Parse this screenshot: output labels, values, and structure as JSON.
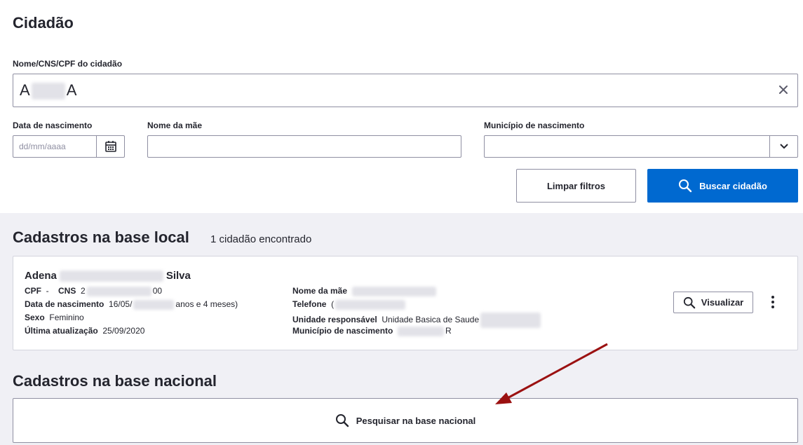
{
  "page": {
    "title": "Cidadão"
  },
  "search": {
    "label": "Nome/CNS/CPF do cidadão",
    "value_start": "A",
    "value_end": "A",
    "clear_icon": "close-icon"
  },
  "filters": {
    "birthdate_label": "Data de nascimento",
    "birthdate_placeholder": "dd/mm/aaaa",
    "mother_label": "Nome da mãe",
    "mother_value": "",
    "municipality_label": "Município de nascimento",
    "municipality_value": ""
  },
  "actions": {
    "clear_label": "Limpar filtros",
    "search_label": "Buscar cidadão"
  },
  "local": {
    "title": "Cadastros na base local",
    "count_text": "1 cidadão encontrado",
    "citizen": {
      "name_first": "Adena",
      "name_last": "Silva",
      "cpf_label": "CPF",
      "cpf_value": "-",
      "cns_label": "CNS",
      "cns_start": "2",
      "cns_end": "00",
      "birthdate_label": "Data de nascimento",
      "birthdate_start": "16/05/",
      "birthdate_end": "anos e 4 meses)",
      "sex_label": "Sexo",
      "sex_value": "Feminino",
      "updated_label": "Última atualização",
      "updated_value": "25/09/2020",
      "mother_label": "Nome da mãe",
      "phone_label": "Telefone",
      "phone_start": "(",
      "unit_label": "Unidade responsável",
      "unit_value": "Unidade Basica de Saude",
      "municipality_label": "Município de nascimento",
      "municipality_end": "R"
    },
    "view_label": "Visualizar"
  },
  "national": {
    "title": "Cadastros na base nacional",
    "search_label": "Pesquisar na base nacional"
  },
  "colors": {
    "primary": "#0069d0",
    "section_bg": "#f0f0f5",
    "annotation_arrow": "#9b1111"
  }
}
